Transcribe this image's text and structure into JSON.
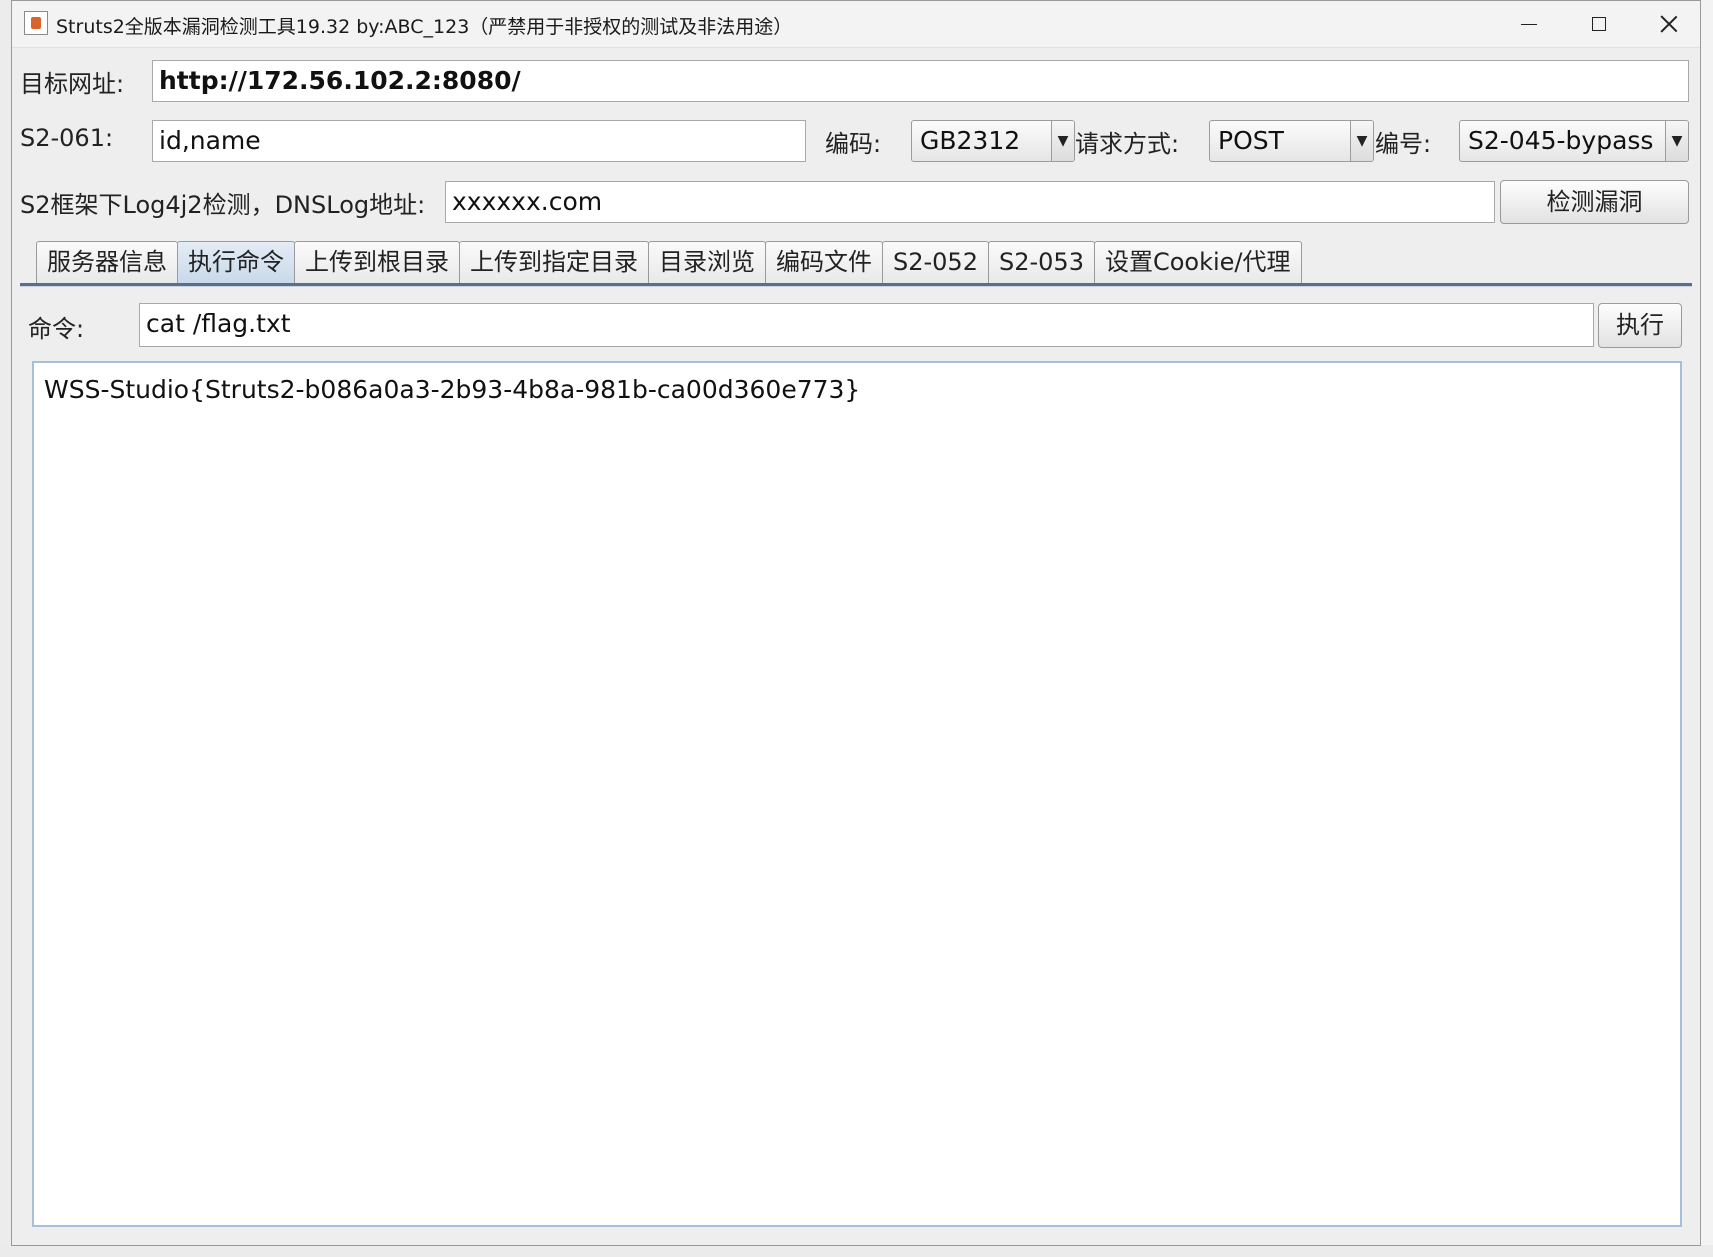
{
  "window": {
    "title": "Struts2全版本漏洞检测工具19.32 by:ABC_123（严禁用于非授权的测试及非法用途）"
  },
  "form": {
    "target_url_label": "目标网址:",
    "target_url_value": "http://172.56.102.2:8080/",
    "s2_061_label": "S2-061:",
    "s2_061_value": "id,name",
    "encoding_label": "编码:",
    "encoding_value": "GB2312",
    "method_label": "请求方式:",
    "method_value": "POST",
    "number_label": "编号:",
    "number_value": "S2-045-bypass",
    "log4j_label": "S2框架下Log4j2检测，DNSLog地址:",
    "dnslog_value": "xxxxxx.com",
    "detect_button": "检测漏洞"
  },
  "tabs": [
    {
      "label": "服务器信息",
      "active": false
    },
    {
      "label": "执行命令",
      "active": true
    },
    {
      "label": "上传到根目录",
      "active": false
    },
    {
      "label": "上传到指定目录",
      "active": false
    },
    {
      "label": "目录浏览",
      "active": false
    },
    {
      "label": "编码文件",
      "active": false
    },
    {
      "label": "S2-052",
      "active": false
    },
    {
      "label": "S2-053",
      "active": false
    },
    {
      "label": "设置Cookie/代理",
      "active": false
    }
  ],
  "command": {
    "label": "命令:",
    "value": "cat /flag.txt",
    "execute_button": "执行"
  },
  "output": {
    "text": "WSS-Studio{Struts2-b086a0a3-2b93-4b8a-981b-ca00d360e773}"
  }
}
